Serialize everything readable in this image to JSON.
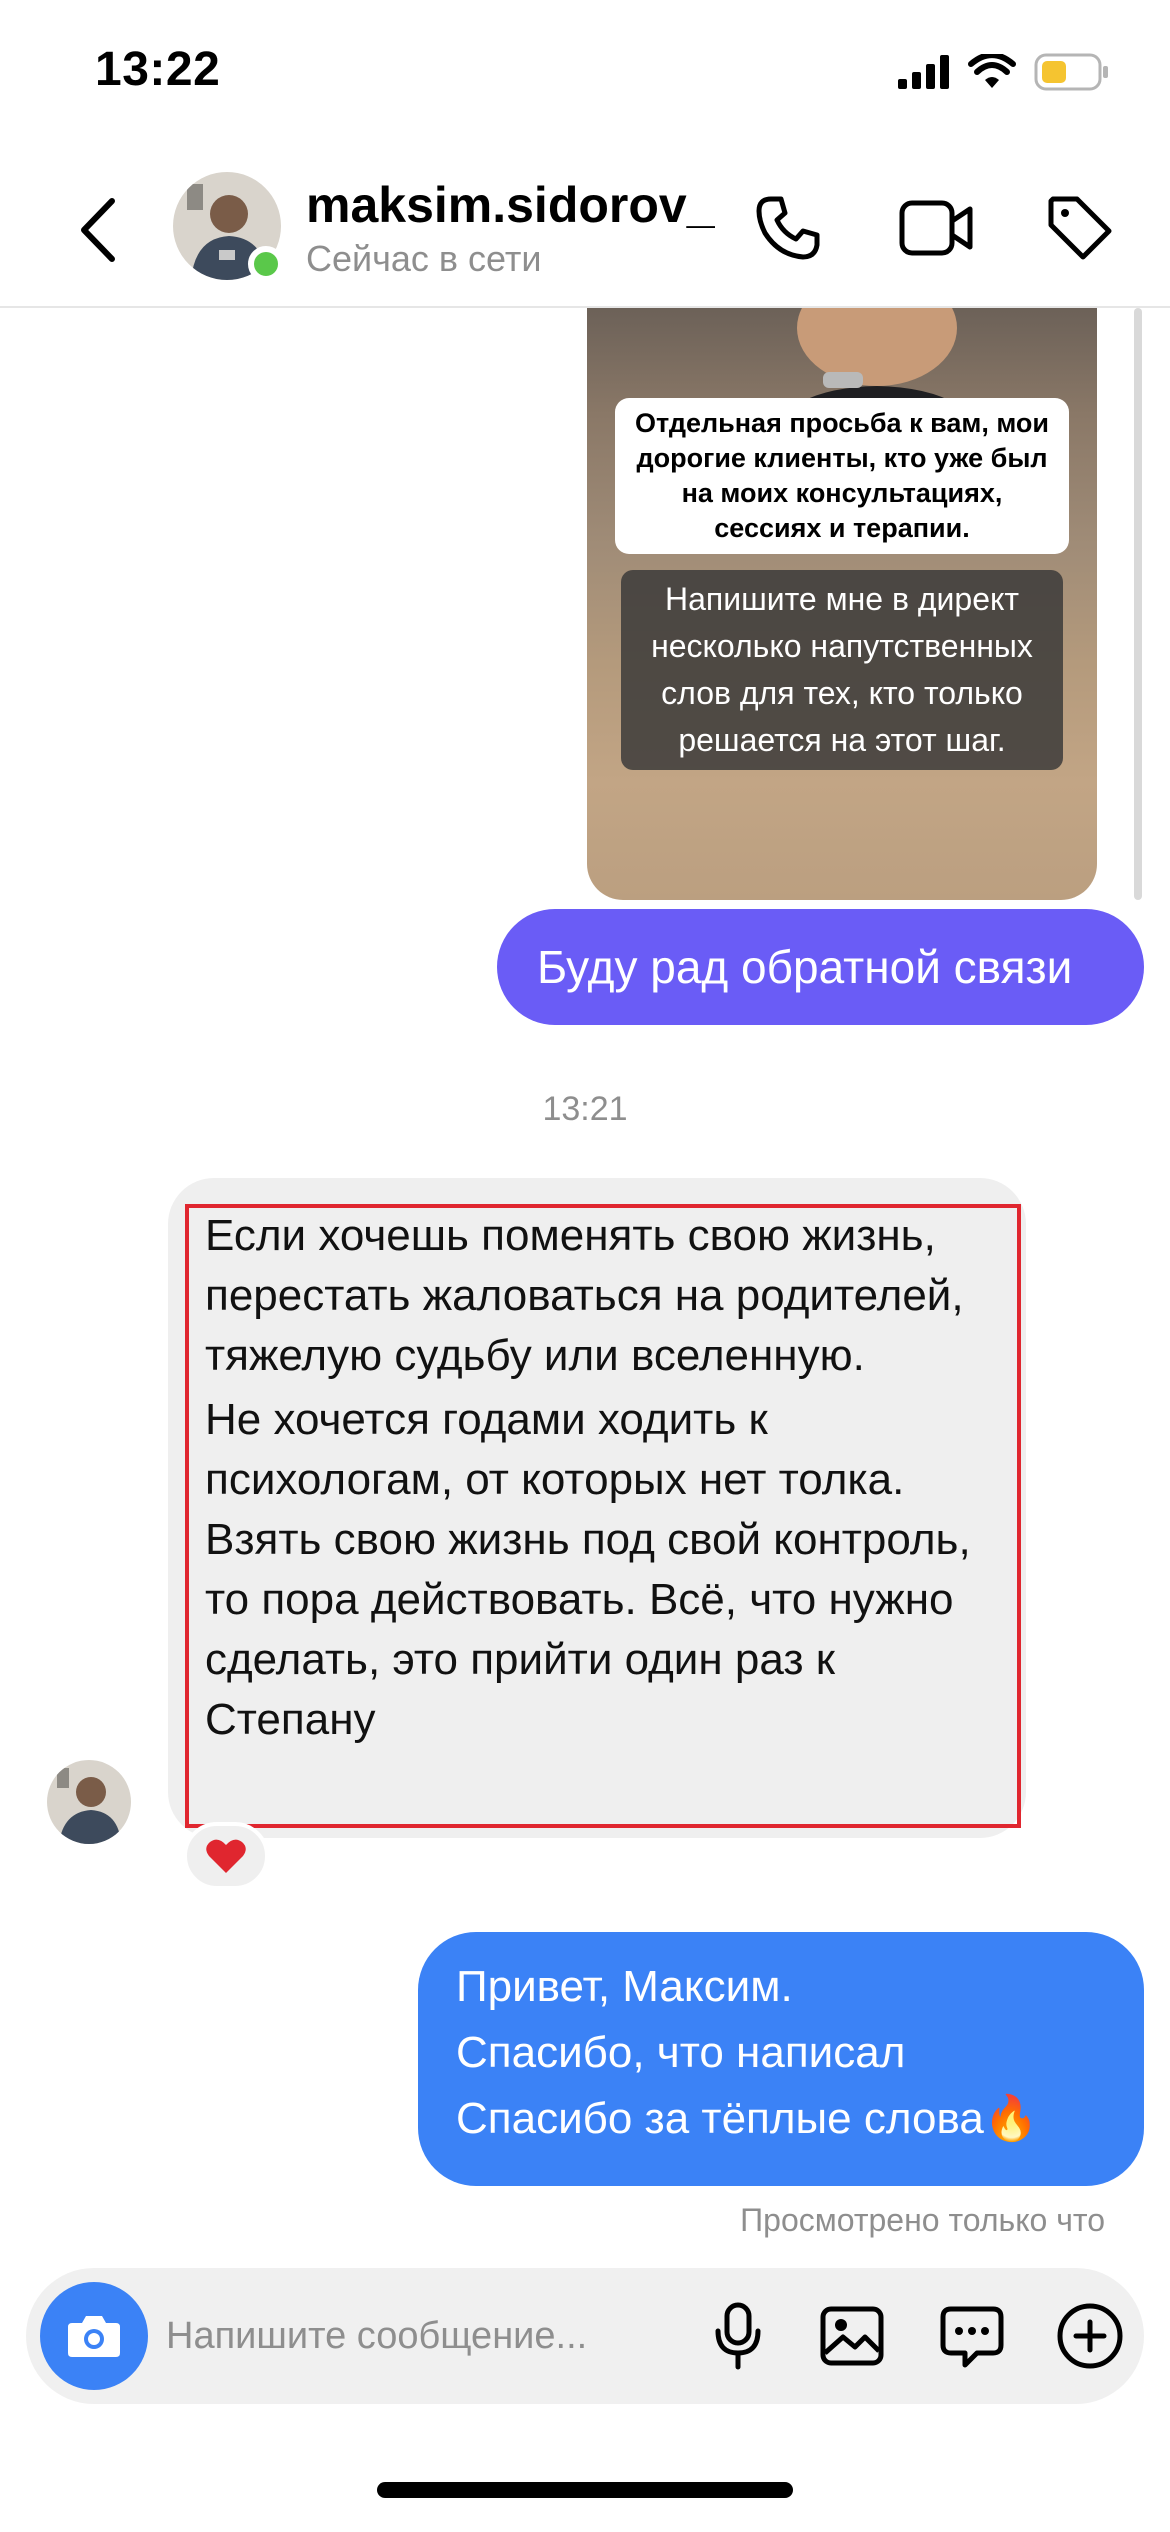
{
  "status_bar": {
    "time": "13:22",
    "icons": [
      "signal-icon",
      "wifi-icon",
      "battery-icon"
    ],
    "battery_color": "#f5c430"
  },
  "header": {
    "back_icon": "chevron-left-icon",
    "contact_name": "maksim.sidorov_",
    "contact_status": "Сейчас в сети",
    "online_color": "#5ac84a",
    "actions": [
      "phone-icon",
      "video-icon",
      "tag-icon"
    ]
  },
  "thread": {
    "story": {
      "caption_white": "Отдельная просьба к вам, мои дорогие клиенты, кто уже был на моих консультациях, сессиях и терапии.",
      "caption_dark": "Напишите мне в директ несколько напутственных слов для тех, кто только решается на этот шаг."
    },
    "outgoing_1": "Буду рад обратной связи",
    "time_separator": "13:21",
    "incoming": {
      "paragraph_1": "Если хочешь поменять свою жизнь, перестать жаловаться на родителей, тяжелую судьбу или вселенную.",
      "paragraph_2": "Не хочется годами ходить к психологам, от которых нет толка. Взять свою жизнь под свой контроль, то пора действовать. Всё, что нужно сделать, это прийти один раз к Степану",
      "reaction": "❤️"
    },
    "outgoing_2": {
      "line_1": "Привет, Максим.",
      "line_2": "Спасибо, что написал",
      "line_3": "Спасибо за тёплые слова🔥"
    },
    "seen_status": "Просмотрено только что"
  },
  "composer": {
    "placeholder": "Напишите сообщение...",
    "actions": [
      "camera-icon",
      "microphone-icon",
      "gallery-icon",
      "sticker-icon",
      "plus-icon"
    ]
  },
  "colors": {
    "purple_bubble": "#6a5cf6",
    "blue_bubble": "#3b82f6",
    "incoming_bubble": "#efefef",
    "highlight_frame": "#e0262f"
  }
}
